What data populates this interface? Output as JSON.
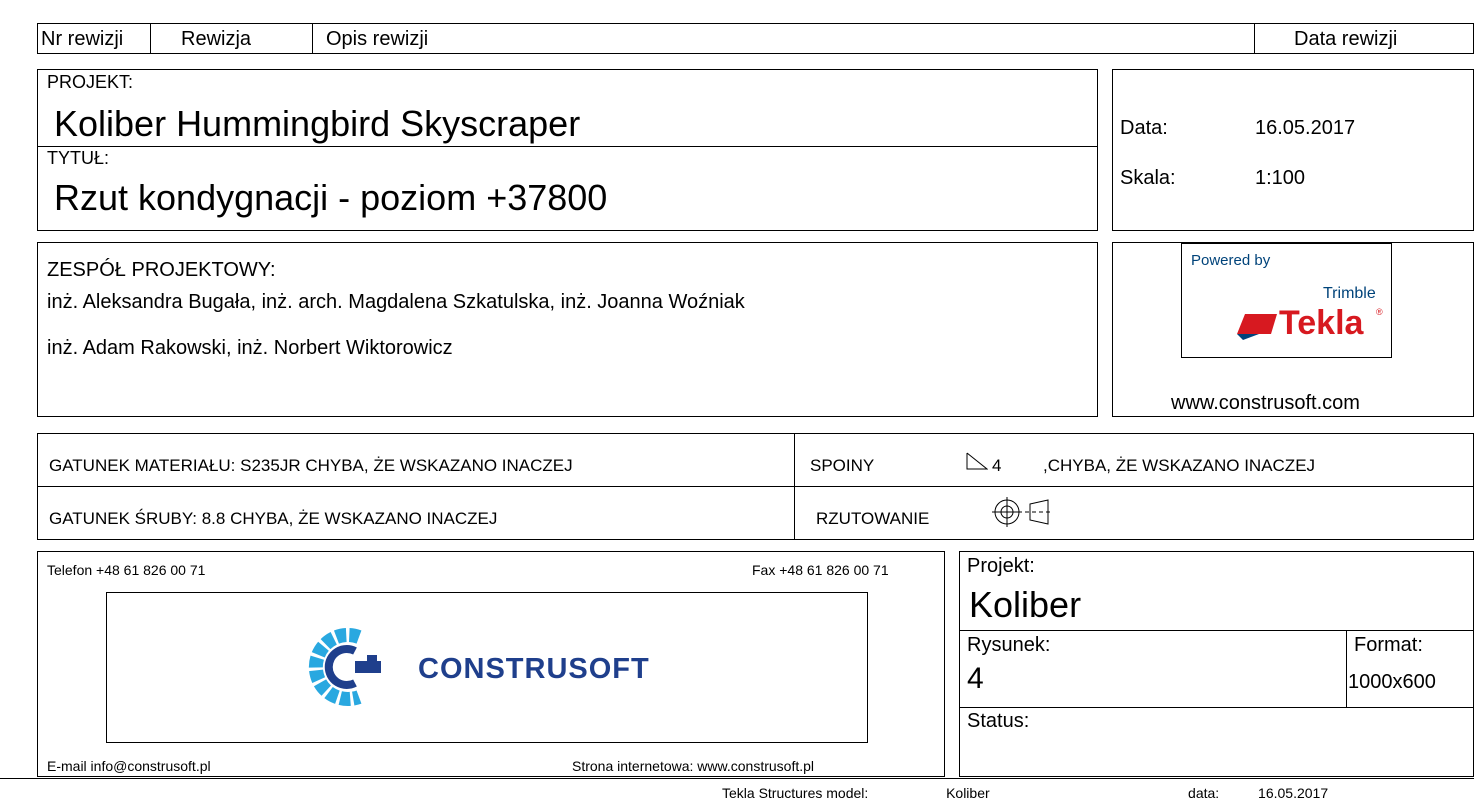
{
  "revision_table": {
    "nr_label": "Nr rewizji",
    "rev_label": "Rewizja",
    "desc_label": "Opis rewizji",
    "date_label": "Data rewizji"
  },
  "project_section": {
    "project_label": "PROJEKT:",
    "project_value": "Koliber Hummingbird Skyscraper",
    "title_label": "TYTUŁ:",
    "title_value": "Rzut kondygnacji  - poziom +37800"
  },
  "meta": {
    "date_label": "Data:",
    "date_value": "16.05.2017",
    "scale_label": "Skala:",
    "scale_value": "1:100"
  },
  "team": {
    "label": "ZESPÓŁ PROJEKTOWY:",
    "line1": "inż. Aleksandra Bugała, inż. arch. Magdalena Szkatulska, inż. Joanna Woźniak",
    "line2": "inż. Adam Rakowski, inż. Norbert Wiktorowicz"
  },
  "tekla_logo": {
    "powered_by": "Powered by",
    "trimble": "Trimble",
    "tekla": "Tekla",
    "registered": "®",
    "brand_red": "#d71920",
    "brand_blue": "#00437a"
  },
  "website": "www.construsoft.com",
  "specs": {
    "material": "GATUNEK MATERIAŁU: S235JR CHYBA, ŻE WSKAZANO INACZEJ",
    "welds_label": "SPOINY",
    "weld_size": "4",
    "welds_note": ",CHYBA, ŻE WSKAZANO INACZEJ",
    "bolts": "GATUNEK ŚRUBY: 8.8  CHYBA, ŻE WSKAZANO INACZEJ",
    "projection_label": "RZUTOWANIE"
  },
  "contact": {
    "phone": "Telefon +48 61 826 00 71",
    "fax": "Fax +48 61 826 00 71",
    "email": "E-mail info@construsoft.pl",
    "web": "Strona internetowa: www.construsoft.pl"
  },
  "construsoft_logo": {
    "name": "CONSTRUSOFT",
    "brand_blue": "#1f3f8c",
    "brand_light": "#29a8e0"
  },
  "drawing_info": {
    "project_label": "Projekt:",
    "project_value": "Koliber",
    "drawing_label": "Rysunek:",
    "drawing_value": "4",
    "format_label": "Format:",
    "format_value": "1000x600",
    "status_label": "Status:"
  },
  "footer": {
    "text": "Tekla Structures model:                    Koliber                                                   data:          16.05.2017"
  }
}
